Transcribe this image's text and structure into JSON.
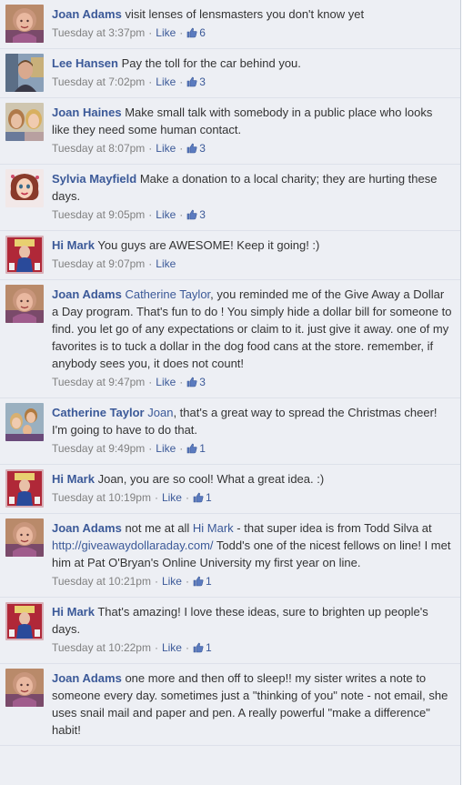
{
  "comments": [
    {
      "author": "Joan Adams",
      "avatar": "avatar-joan-adams",
      "segments": [
        {
          "t": "visit lenses of lensmasters you don't know yet"
        }
      ],
      "time": "Tuesday at 3:37pm",
      "like_label": "Like",
      "likes": "6"
    },
    {
      "author": "Lee Hansen",
      "avatar": "avatar-lee-hansen",
      "segments": [
        {
          "t": "Pay the toll for the car behind you."
        }
      ],
      "time": "Tuesday at 7:02pm",
      "like_label": "Like",
      "likes": "3"
    },
    {
      "author": "Joan Haines",
      "avatar": "avatar-joan-haines",
      "segments": [
        {
          "t": "Make small talk with somebody in a public place who looks like they need some human contact."
        }
      ],
      "time": "Tuesday at 8:07pm",
      "like_label": "Like",
      "likes": "3"
    },
    {
      "author": "Sylvia Mayfield",
      "avatar": "avatar-sylvia-mayfield",
      "segments": [
        {
          "t": "Make a donation to a local charity; they are hurting these days."
        }
      ],
      "time": "Tuesday at 9:05pm",
      "like_label": "Like",
      "likes": "3"
    },
    {
      "author": "Hi Mark",
      "avatar": "avatar-hi-mark",
      "segments": [
        {
          "t": "You guys are AWESOME! Keep it going! :)"
        }
      ],
      "time": "Tuesday at 9:07pm",
      "like_label": "Like",
      "likes": ""
    },
    {
      "author": "Joan Adams",
      "avatar": "avatar-joan-adams",
      "segments": [
        {
          "t": "Catherine Taylor",
          "link": true
        },
        {
          "t": ", you reminded me of the Give Away a Dollar a Day program. That's fun to do ! You simply hide a dollar bill for someone to find. you let go of any expectations or claim to it. just give it away. one of my favorites is to tuck a dollar in the dog food cans at the store. remember, if anybody sees you, it does not count!"
        }
      ],
      "time": "Tuesday at 9:47pm",
      "like_label": "Like",
      "likes": "3"
    },
    {
      "author": "Catherine Taylor",
      "avatar": "avatar-catherine-taylor",
      "segments": [
        {
          "t": "Joan",
          "link": true
        },
        {
          "t": ", that's a great way to spread the Christmas cheer! I'm going to have to do that."
        }
      ],
      "time": "Tuesday at 9:49pm",
      "like_label": "Like",
      "likes": "1"
    },
    {
      "author": "Hi Mark",
      "avatar": "avatar-hi-mark",
      "segments": [
        {
          "t": "Joan, you are so cool! What a great idea. :)"
        }
      ],
      "time": "Tuesday at 10:19pm",
      "like_label": "Like",
      "likes": "1"
    },
    {
      "author": "Joan Adams",
      "avatar": "avatar-joan-adams",
      "segments": [
        {
          "t": "not me at all "
        },
        {
          "t": "Hi Mark",
          "link": true
        },
        {
          "t": " - that super idea is from Todd Silva at "
        },
        {
          "t": "http://giveawaydollaraday.com/",
          "link": true
        },
        {
          "t": " Todd's one of the nicest fellows on line! I met him at Pat O'Bryan's Online University my first year on line."
        }
      ],
      "time": "Tuesday at 10:21pm",
      "like_label": "Like",
      "likes": "1"
    },
    {
      "author": "Hi Mark",
      "avatar": "avatar-hi-mark",
      "segments": [
        {
          "t": "That's amazing! I love these ideas, sure to brighten up people's days."
        }
      ],
      "time": "Tuesday at 10:22pm",
      "like_label": "Like",
      "likes": "1"
    },
    {
      "author": "Joan Adams",
      "avatar": "avatar-joan-adams",
      "segments": [
        {
          "t": "one more and then off to sleep!! my sister writes a note to someone every day. sometimes just a \"thinking of you\" note - not email, she uses snail mail and paper and pen. A really powerful \"make a difference\" habit!"
        }
      ],
      "time": "",
      "like_label": "",
      "likes": ""
    }
  ]
}
